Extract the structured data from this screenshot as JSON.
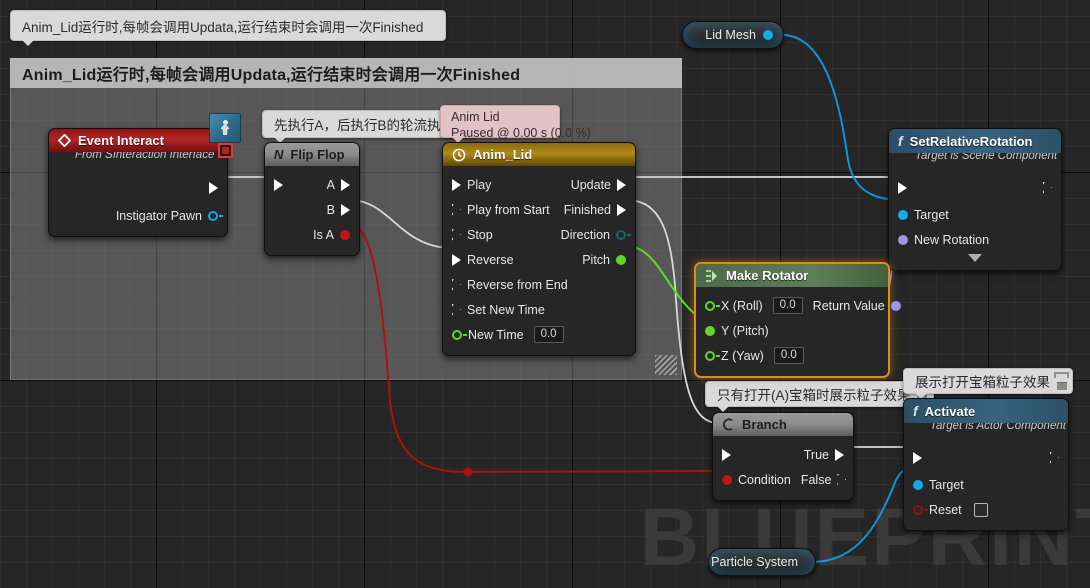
{
  "editor": {
    "watermark": "BLUEPRINT"
  },
  "comment": {
    "title": "Anim_Lid运行时,每帧会调用Updata,运行结束时会调用一次Finished"
  },
  "tooltips": {
    "comment_hint": "Anim_Lid运行时,每帧会调用Updata,运行结束时会调用一次Finished",
    "flipflop_hint": "先执行A，后执行B的轮流执行",
    "branch_hint": "只有打开(A)宝箱时展示粒子效果",
    "activate_hint": "展示打开宝箱粒子效果",
    "timeline_status_title": "Anim Lid",
    "timeline_status_detail": "Paused @ 0.00 s (0.0 %)"
  },
  "nodes": {
    "event_interact": {
      "title": "Event Interact",
      "subtitle": "From SInteraction Interface",
      "outputs": [
        {
          "label": "",
          "type": "exec"
        },
        {
          "label": "Instigator Pawn",
          "type": "object"
        }
      ]
    },
    "flip_flop": {
      "title": "Flip Flop",
      "icon": "flipflop-icon",
      "inputs": [
        {
          "label": "",
          "type": "exec"
        }
      ],
      "outputs": [
        {
          "label": "A",
          "type": "exec"
        },
        {
          "label": "B",
          "type": "exec"
        },
        {
          "label": "Is A",
          "type": "bool"
        }
      ]
    },
    "anim_lid": {
      "title": "Anim_Lid",
      "icon": "clock-icon",
      "inputs": [
        {
          "label": "Play",
          "type": "exec",
          "filled": true
        },
        {
          "label": "Play from Start",
          "type": "exec",
          "filled": false
        },
        {
          "label": "Stop",
          "type": "exec",
          "filled": false
        },
        {
          "label": "Reverse",
          "type": "exec",
          "filled": true
        },
        {
          "label": "Reverse from End",
          "type": "exec",
          "filled": false
        },
        {
          "label": "Set New Time",
          "type": "exec",
          "filled": false
        },
        {
          "label": "New Time",
          "type": "float",
          "value": "0.0"
        }
      ],
      "outputs": [
        {
          "label": "Update",
          "type": "exec",
          "filled": true
        },
        {
          "label": "Finished",
          "type": "exec",
          "filled": true
        },
        {
          "label": "Direction",
          "type": "byte"
        },
        {
          "label": "Pitch",
          "type": "float"
        }
      ]
    },
    "set_relative_rotation": {
      "title": "SetRelativeRotation",
      "subtitle": "Target is Scene Component",
      "inputs": [
        {
          "label": "",
          "type": "exec"
        },
        {
          "label": "Target",
          "type": "object"
        },
        {
          "label": "New Rotation",
          "type": "rotator"
        }
      ],
      "outputs": [
        {
          "label": "",
          "type": "exec"
        }
      ]
    },
    "make_rotator": {
      "title": "Make Rotator",
      "selected": true,
      "inputs": [
        {
          "label": "X (Roll)",
          "type": "float",
          "value": "0.0"
        },
        {
          "label": "Y (Pitch)",
          "type": "float",
          "connected": true
        },
        {
          "label": "Z (Yaw)",
          "type": "float",
          "value": "0.0"
        }
      ],
      "outputs": [
        {
          "label": "Return Value",
          "type": "rotator"
        }
      ]
    },
    "branch": {
      "title": "Branch",
      "inputs": [
        {
          "label": "",
          "type": "exec"
        },
        {
          "label": "Condition",
          "type": "bool"
        }
      ],
      "outputs": [
        {
          "label": "True",
          "type": "exec",
          "filled": true
        },
        {
          "label": "False",
          "type": "exec",
          "filled": false
        }
      ]
    },
    "activate": {
      "title": "Activate",
      "subtitle": "Target is Actor Component",
      "inputs": [
        {
          "label": "",
          "type": "exec"
        },
        {
          "label": "Target",
          "type": "object"
        },
        {
          "label": "Reset",
          "type": "bool",
          "checkbox": true
        }
      ],
      "outputs": [
        {
          "label": "",
          "type": "exec"
        }
      ]
    },
    "lid_mesh": {
      "title": "Lid Mesh",
      "type": "object"
    },
    "particle_system": {
      "title": "Particle System",
      "type": "object"
    }
  },
  "colors": {
    "exec_wire": "#d8d8d8",
    "bool_wire": "#b00f0f",
    "float_wire": "#5ce02a",
    "object_wire": "#0e97dd",
    "rotator_wire": "#9a96e8",
    "object_pin": "#16a9e8",
    "bool_pin": "#c01616",
    "float_pin": "#62d62a",
    "byte_pin": "#0c6b62",
    "rotator_pin": "#9a96e8",
    "header_red": "#b52424",
    "header_gold": "#b08a18",
    "header_blue": "#37637f",
    "header_green": "#5d7f57",
    "selection": "#e08a18"
  }
}
